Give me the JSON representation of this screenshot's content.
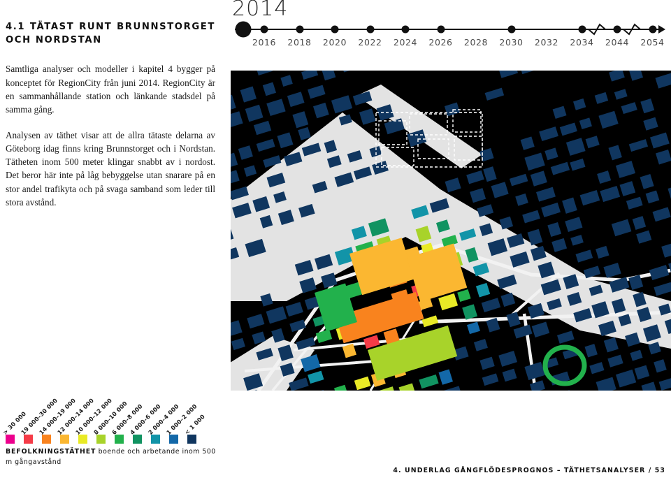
{
  "section": {
    "number_and_title": "4.1 TÄTAST RUNT BRUNNSTORGET OCH NORDSTAN",
    "paragraphs": [
      "Samtliga analyser och modeller i kapitel 4 bygger på konceptet för RegionCity från juni 2014. RegionCity är en sammanhållande station och länkande stadsdel på samma gång.",
      "Analysen av täthet visar att de allra tätaste delarna av Göteborg idag finns kring Brunnstorget och i Nordstan. Tätheten inom 500 meter klingar snabbt av i nordost. Det beror här inte på låg bebyggelse utan snarare på en stor andel trafikyta och på svaga samband som leder till stora avstånd."
    ]
  },
  "timeline": {
    "current_year": "2014",
    "ticks": [
      {
        "label": "2016",
        "dot": true
      },
      {
        "label": "2018",
        "dot": true
      },
      {
        "label": "2020",
        "dot": true
      },
      {
        "label": "2022",
        "dot": true
      },
      {
        "label": "2024",
        "dot": true
      },
      {
        "label": "2026",
        "dot": true
      },
      {
        "label": "2028",
        "dot": false
      },
      {
        "label": "2030",
        "dot": true
      },
      {
        "label": "2032",
        "dot": false
      },
      {
        "label": "2034",
        "dot": true
      },
      {
        "label": "2044",
        "dot": true
      },
      {
        "label": "2054",
        "dot": true
      }
    ],
    "line_color": "#111111",
    "label_color": "#4c4c4c"
  },
  "legend": {
    "caption_strong": "BEFOLKNINGSTÄTHET",
    "caption_rest": "boende och arbetande inom 500 m gångavstånd",
    "items": [
      {
        "label": "> 30 000",
        "color": "#ec008c"
      },
      {
        "label": "19 000–30 000",
        "color": "#f53b47"
      },
      {
        "label": "14 000–19 000",
        "color": "#f9831e"
      },
      {
        "label": "12 000–14 000",
        "color": "#fbb731"
      },
      {
        "label": "10 000–12 000",
        "color": "#e9ea26"
      },
      {
        "label": "8 000–10 000",
        "color": "#a8d32a"
      },
      {
        "label": "6 000–8 000",
        "color": "#22b14c"
      },
      {
        "label": "4 000–6 000",
        "color": "#119361"
      },
      {
        "label": "2 000–4 000",
        "color": "#1294a8"
      },
      {
        "label": "1 000–2 000",
        "color": "#1368a8"
      },
      {
        "label": "< 1 000",
        "color": "#10365f"
      }
    ]
  },
  "map": {
    "background_color": "#000000",
    "water_color": "#e3e3e3",
    "road_color": "#f2f2f2",
    "alt_label": "Täthetskarta Göteborg centrum"
  },
  "footer": {
    "text": "4. UNDERLAG GÅNGFLÖDESPROGNOS – TÄTHETSANALYSER / 53"
  }
}
